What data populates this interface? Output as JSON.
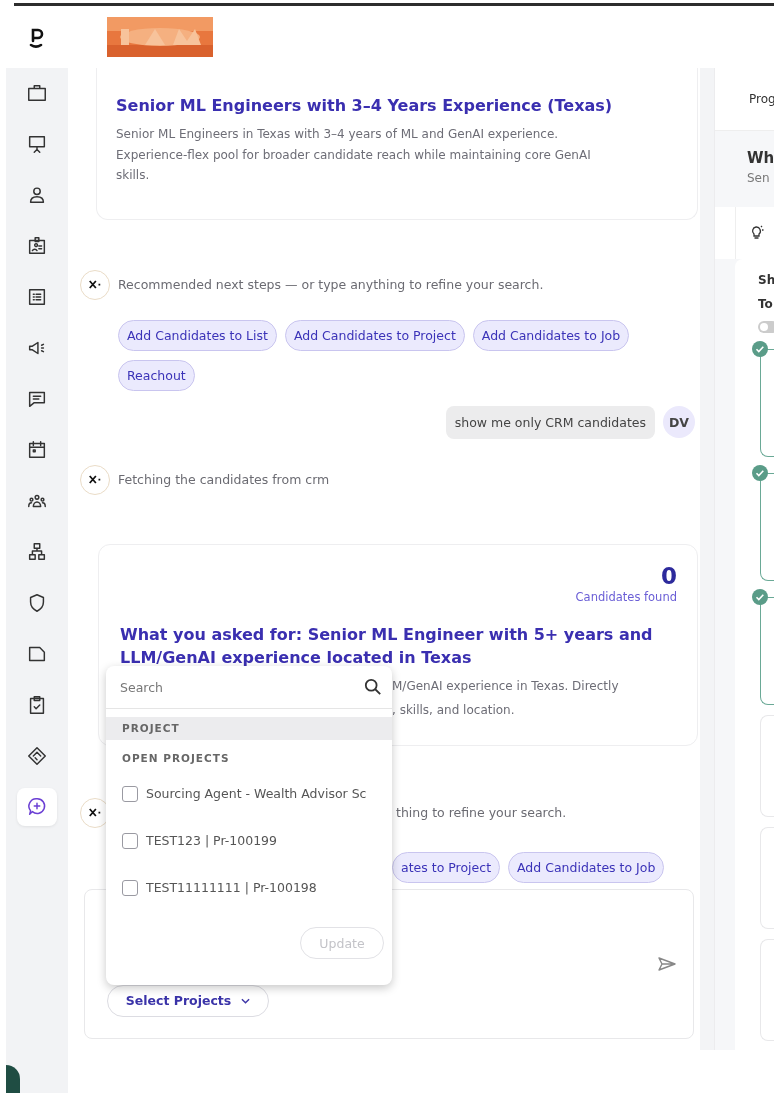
{
  "sidebar": {
    "items": [
      {
        "selected": false
      },
      {
        "selected": false
      },
      {
        "selected": false
      },
      {
        "selected": false
      },
      {
        "selected": false
      },
      {
        "selected": false
      },
      {
        "selected": false
      },
      {
        "selected": false
      },
      {
        "selected": false
      },
      {
        "selected": false
      },
      {
        "selected": false
      },
      {
        "selected": false
      },
      {
        "selected": false
      },
      {
        "selected": false
      },
      {
        "selected": true
      }
    ]
  },
  "chat": {
    "result_card_1": {
      "title": "Senior ML Engineers with 3–4 Years Experience (Texas)",
      "description": "Senior ML Engineers in Texas with 3–4 years of ML and GenAI experience. Experience-flex pool for broader candidate reach while maintaining core GenAI skills."
    },
    "assistant_message_1": {
      "text": "Recommended next steps — or type anything to refine your search.",
      "actions": [
        "Add Candidates to List",
        "Add Candidates to Project",
        "Add Candidates to Job",
        "Reachout"
      ]
    },
    "user_message": {
      "text": "show me only CRM candidates",
      "avatar": "DV"
    },
    "assistant_message_2": {
      "text": "Fetching the candidates from crm"
    },
    "result_card_2": {
      "count": "0",
      "count_label": "Candidates found",
      "title": "What you asked for: Senior ML Engineer with 5+ years and LLM/GenAI experience located in Texas",
      "description_lines": [
        "M/GenAI experience in Texas. Directly",
        ", skills, and location."
      ]
    },
    "assistant_message_3": {
      "text": "thing to refine your search.",
      "actions": [
        "ates to Project",
        "Add Candidates to Job"
      ]
    },
    "composer": {
      "project_button": "Select Projects"
    }
  },
  "project_dropdown": {
    "search_placeholder": "Search",
    "section": "PROJECT",
    "group": "OPEN PROJECTS",
    "options": [
      {
        "label": "Sourcing Agent - Wealth Advisor Sc",
        "checked": false
      },
      {
        "label": "TEST123 | Pr-100199",
        "checked": false
      },
      {
        "label": "TEST11111111 | Pr-100198",
        "checked": false
      }
    ],
    "update_button": "Update",
    "update_disabled": true
  },
  "right_panel": {
    "tab": "Prog",
    "heading": "Wh",
    "subheading": "Sen",
    "line_1": "Sh",
    "line_2": "To",
    "toggle_on": false,
    "steps": [
      {
        "completed": true
      },
      {
        "completed": true
      },
      {
        "completed": true
      },
      {
        "completed": false
      },
      {
        "completed": false
      },
      {
        "completed": false
      }
    ]
  }
}
